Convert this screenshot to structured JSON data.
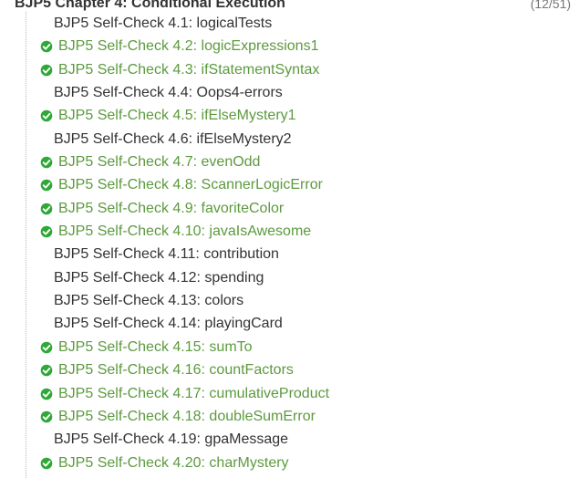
{
  "chapter": {
    "title": "BJP5 Chapter 4: Conditional Execution",
    "count": "(12/51)"
  },
  "colors": {
    "solved": "#5c9a3e",
    "unsolved": "#333333",
    "check": "#2ea836"
  },
  "problems": [
    {
      "label": "BJP5 Self-Check 4.1: logicalTests",
      "solved": false
    },
    {
      "label": "BJP5 Self-Check 4.2: logicExpressions1",
      "solved": true
    },
    {
      "label": "BJP5 Self-Check 4.3: ifStatementSyntax",
      "solved": true
    },
    {
      "label": "BJP5 Self-Check 4.4: Oops4-errors",
      "solved": false
    },
    {
      "label": "BJP5 Self-Check 4.5: ifElseMystery1",
      "solved": true
    },
    {
      "label": "BJP5 Self-Check 4.6: ifElseMystery2",
      "solved": false
    },
    {
      "label": "BJP5 Self-Check 4.7: evenOdd",
      "solved": true
    },
    {
      "label": "BJP5 Self-Check 4.8: ScannerLogicError",
      "solved": true
    },
    {
      "label": "BJP5 Self-Check 4.9: favoriteColor",
      "solved": true
    },
    {
      "label": "BJP5 Self-Check 4.10: javaIsAwesome",
      "solved": true
    },
    {
      "label": "BJP5 Self-Check 4.11: contribution",
      "solved": false
    },
    {
      "label": "BJP5 Self-Check 4.12: spending",
      "solved": false
    },
    {
      "label": "BJP5 Self-Check 4.13: colors",
      "solved": false
    },
    {
      "label": "BJP5 Self-Check 4.14: playingCard",
      "solved": false
    },
    {
      "label": "BJP5 Self-Check 4.15: sumTo",
      "solved": true
    },
    {
      "label": "BJP5 Self-Check 4.16: countFactors",
      "solved": true
    },
    {
      "label": "BJP5 Self-Check 4.17: cumulativeProduct",
      "solved": true
    },
    {
      "label": "BJP5 Self-Check 4.18: doubleSumError",
      "solved": true
    },
    {
      "label": "BJP5 Self-Check 4.19: gpaMessage",
      "solved": false
    },
    {
      "label": "BJP5 Self-Check 4.20: charMystery",
      "solved": true
    }
  ]
}
